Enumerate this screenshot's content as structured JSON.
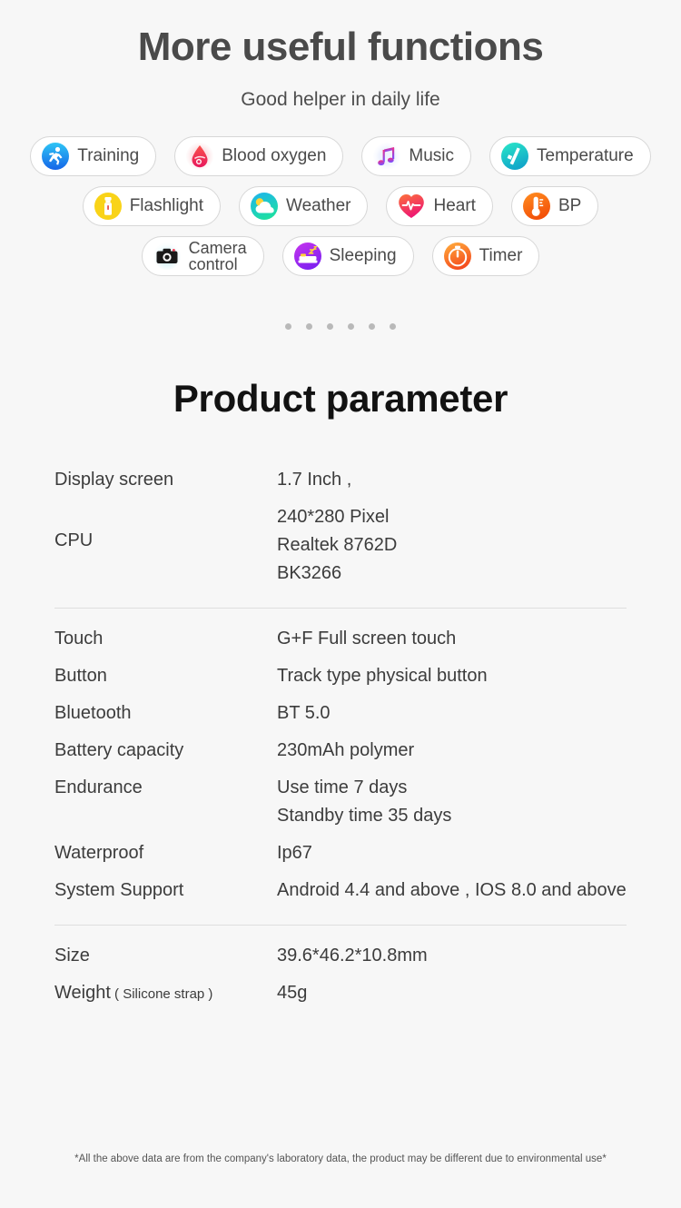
{
  "hero": {
    "title": "More useful functions",
    "subtitle": "Good helper in daily life"
  },
  "features": {
    "rows": [
      [
        {
          "label": "Training",
          "icon": "running-person-icon"
        },
        {
          "label": "Blood oxygen",
          "icon": "blood-drop-icon"
        },
        {
          "label": "Music",
          "icon": "music-note-icon"
        },
        {
          "label": "Temperature",
          "icon": "thermometer-gun-icon"
        }
      ],
      [
        {
          "label": "Flashlight",
          "icon": "flashlight-icon"
        },
        {
          "label": "Weather",
          "icon": "sun-cloud-icon"
        },
        {
          "label": "Heart",
          "icon": "heart-pulse-icon"
        },
        {
          "label": "BP",
          "icon": "thermometer-icon"
        }
      ],
      [
        {
          "label": "Camera\ncontrol",
          "icon": "camera-icon"
        },
        {
          "label": "Sleeping",
          "icon": "bed-icon"
        },
        {
          "label": "Timer",
          "icon": "stopwatch-icon"
        }
      ]
    ]
  },
  "pagination": {
    "dot_count": 6,
    "dot_color": "#b9b9b9"
  },
  "parameters": {
    "title": "Product parameter",
    "groups": [
      {
        "rows": [
          {
            "key": "Display screen",
            "value": "1.7 Inch ,"
          },
          {
            "key": "CPU",
            "value": "240*280 Pixel\nRealtek 8762D\nBK3266"
          }
        ]
      },
      {
        "rows": [
          {
            "key": "Touch",
            "value": "G+F Full screen touch"
          },
          {
            "key": "Button",
            "value": "Track type physical button"
          },
          {
            "key": "Bluetooth",
            "value": "BT 5.0"
          },
          {
            "key": "Battery capacity",
            "value": "230mAh polymer"
          },
          {
            "key": "Endurance",
            "value": "Use time 7 days\nStandby time 35 days"
          },
          {
            "key": "Waterproof",
            "value": "Ip67"
          },
          {
            "key": "System Support",
            "value": "Android 4.4 and above , IOS 8.0 and above"
          }
        ]
      },
      {
        "rows": [
          {
            "key": "Size",
            "value": "39.6*46.2*10.8mm"
          },
          {
            "key": "Weight",
            "key_sub": " ( Silicone strap )",
            "value": "45g"
          }
        ]
      }
    ]
  },
  "footnote": "*All the above data are from the company's laboratory data, the product may be different due to environmental use*",
  "colors": {
    "page_bg": "#f7f7f7",
    "pill_border": "#d7d7d7",
    "title": "#4a4a4a",
    "param_title": "#121212",
    "divider": "#dedede"
  }
}
